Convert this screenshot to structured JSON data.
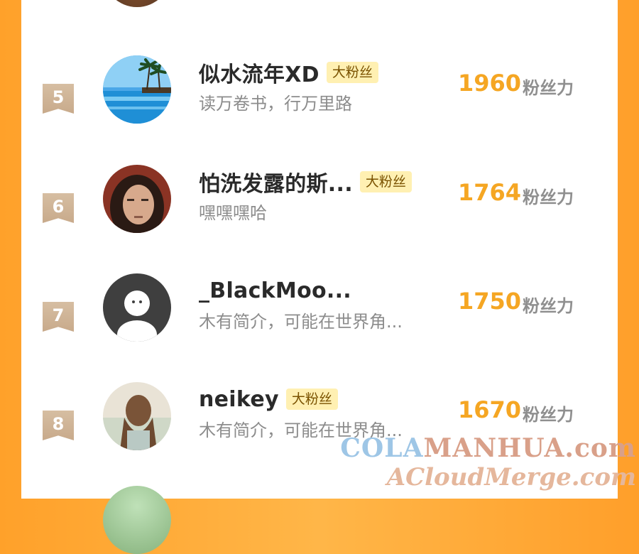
{
  "ranking": {
    "items": [
      {
        "rank": "5",
        "name": "似水流年XD",
        "badge": "大粉丝",
        "bio": "读万卷书，行万里路",
        "score": "1960",
        "unit": "粉丝力"
      },
      {
        "rank": "6",
        "name": "怕洗发露的斯...",
        "badge": "大粉丝",
        "bio": "嘿嘿嘿哈",
        "score": "1764",
        "unit": "粉丝力"
      },
      {
        "rank": "7",
        "name": "_BlackMoo...",
        "badge": "",
        "bio": "木有简介，可能在世界角...",
        "score": "1750",
        "unit": "粉丝力"
      },
      {
        "rank": "8",
        "name": "neikey",
        "badge": "大粉丝",
        "bio": "木有简介，可能在世界角...",
        "score": "1670",
        "unit": "粉丝力"
      }
    ]
  },
  "watermark": {
    "line1_part1": "COLA",
    "line1_part2": "MANHUA.com",
    "line2": "ACloudMerge.com"
  },
  "colors": {
    "score": "#f5a623",
    "badge_bg": "#fff0b2",
    "rank_badge": "#cdb092",
    "background": "#ffa12a"
  }
}
